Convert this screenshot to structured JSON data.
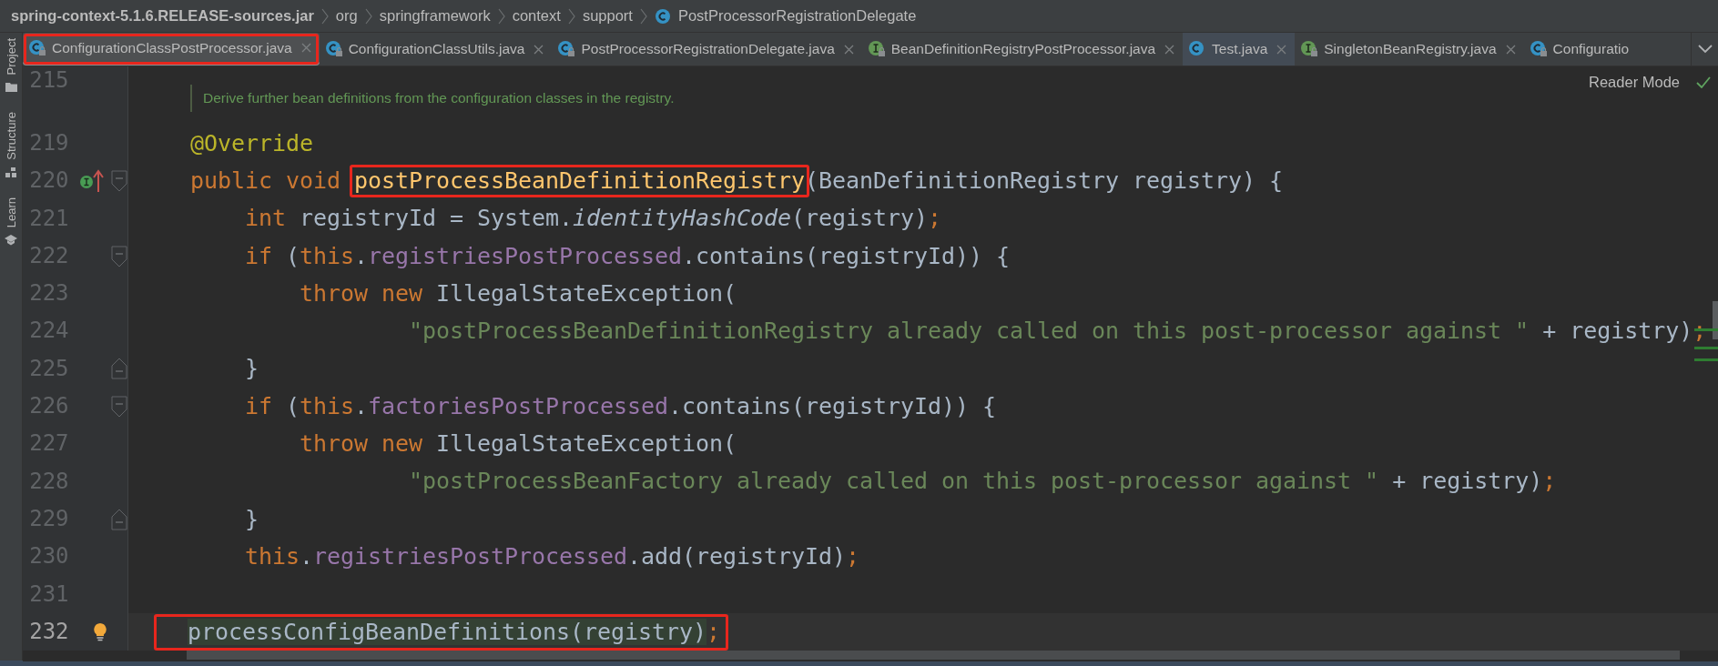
{
  "breadcrumb": [
    {
      "label": "spring-context-5.1.6.RELEASE-sources.jar",
      "kind": "jar"
    },
    {
      "label": "org",
      "kind": "package"
    },
    {
      "label": "springframework",
      "kind": "package"
    },
    {
      "label": "context",
      "kind": "package"
    },
    {
      "label": "support",
      "kind": "package"
    },
    {
      "label": "PostProcessorRegistrationDelegate",
      "kind": "class"
    }
  ],
  "tool_strip": [
    {
      "label": "Project",
      "kind": "project"
    },
    {
      "label": "Structure",
      "kind": "structure"
    },
    {
      "label": "Learn",
      "kind": "learn"
    }
  ],
  "tabs": [
    {
      "label": "ConfigurationClassPostProcessor.java",
      "kind": "class",
      "locked": true,
      "selected": true,
      "hovered": false,
      "outlined": true,
      "closable": true
    },
    {
      "label": "ConfigurationClassUtils.java",
      "kind": "class",
      "locked": true,
      "selected": false,
      "hovered": false,
      "outlined": false,
      "closable": true
    },
    {
      "label": "PostProcessorRegistrationDelegate.java",
      "kind": "class",
      "locked": true,
      "selected": false,
      "hovered": false,
      "outlined": false,
      "closable": true
    },
    {
      "label": "BeanDefinitionRegistryPostProcessor.java",
      "kind": "interface",
      "locked": true,
      "selected": false,
      "hovered": false,
      "outlined": false,
      "closable": true
    },
    {
      "label": "Test.java",
      "kind": "class",
      "locked": false,
      "selected": false,
      "hovered": true,
      "outlined": false,
      "closable": true
    },
    {
      "label": "SingletonBeanRegistry.java",
      "kind": "interface",
      "locked": true,
      "selected": false,
      "hovered": false,
      "outlined": false,
      "closable": true
    },
    {
      "label": "Configuratio",
      "kind": "class",
      "locked": true,
      "selected": false,
      "hovered": false,
      "outlined": false,
      "closable": false
    }
  ],
  "reader_mode": {
    "label": "Reader Mode"
  },
  "doc_comment": {
    "line_number": "215",
    "text": "Derive further bean definitions from the configuration classes in the registry."
  },
  "code": {
    "lines": [
      {
        "number": "219",
        "current": false,
        "tokens": [
          {
            "text": "@Override",
            "kind": "annotation"
          }
        ]
      },
      {
        "number": "220",
        "implements_marker": true,
        "fold_start": true,
        "current": false,
        "tokens": [
          {
            "text": "public void ",
            "kind": "keyword"
          },
          {
            "text": "postProcessBeanDefinitionRegistry",
            "kind": "method",
            "outlined": true
          },
          {
            "text": "(BeanDefinitionRegistry registry) {",
            "kind": "plain"
          }
        ]
      },
      {
        "number": "221",
        "current": false,
        "tokens": [
          {
            "text": "    int",
            "kind": "keyword"
          },
          {
            "text": " registryId = System.",
            "kind": "plain"
          },
          {
            "text": "identityHashCode",
            "kind": "static"
          },
          {
            "text": "(registry)",
            "kind": "plain"
          },
          {
            "text": ";",
            "kind": "keyword"
          }
        ]
      },
      {
        "number": "222",
        "fold_start": true,
        "current": false,
        "tokens": [
          {
            "text": "    if",
            "kind": "keyword"
          },
          {
            "text": " (",
            "kind": "plain"
          },
          {
            "text": "this",
            "kind": "keyword"
          },
          {
            "text": ".",
            "kind": "plain"
          },
          {
            "text": "registriesPostProcessed",
            "kind": "field"
          },
          {
            "text": ".contains(registryId)) {",
            "kind": "plain"
          }
        ]
      },
      {
        "number": "223",
        "current": false,
        "tokens": [
          {
            "text": "        throw new",
            "kind": "keyword"
          },
          {
            "text": " IllegalStateException(",
            "kind": "plain"
          }
        ]
      },
      {
        "number": "224",
        "current": false,
        "tokens": [
          {
            "text": "                \"postProcessBeanDefinitionRegistry already called on this post-processor against \"",
            "kind": "string"
          },
          {
            "text": " + registry)",
            "kind": "plain"
          },
          {
            "text": ";",
            "kind": "keyword"
          }
        ]
      },
      {
        "number": "225",
        "fold_end": true,
        "current": false,
        "tokens": [
          {
            "text": "    }",
            "kind": "plain"
          }
        ]
      },
      {
        "number": "226",
        "fold_start": true,
        "current": false,
        "tokens": [
          {
            "text": "    if",
            "kind": "keyword"
          },
          {
            "text": " (",
            "kind": "plain"
          },
          {
            "text": "this",
            "kind": "keyword"
          },
          {
            "text": ".",
            "kind": "plain"
          },
          {
            "text": "factoriesPostProcessed",
            "kind": "field"
          },
          {
            "text": ".contains(registryId)) {",
            "kind": "plain"
          }
        ]
      },
      {
        "number": "227",
        "current": false,
        "tokens": [
          {
            "text": "        throw new",
            "kind": "keyword"
          },
          {
            "text": " IllegalStateException(",
            "kind": "plain"
          }
        ]
      },
      {
        "number": "228",
        "current": false,
        "tokens": [
          {
            "text": "                \"postProcessBeanFactory already called on this post-processor against \"",
            "kind": "string"
          },
          {
            "text": " + registry)",
            "kind": "plain"
          },
          {
            "text": ";",
            "kind": "keyword"
          }
        ]
      },
      {
        "number": "229",
        "fold_end": true,
        "current": false,
        "tokens": [
          {
            "text": "    }",
            "kind": "plain"
          }
        ]
      },
      {
        "number": "230",
        "current": false,
        "tokens": [
          {
            "text": "    this",
            "kind": "keyword"
          },
          {
            "text": ".",
            "kind": "plain"
          },
          {
            "text": "registriesPostProcessed",
            "kind": "field"
          },
          {
            "text": ".add(registryId)",
            "kind": "plain"
          },
          {
            "text": ";",
            "kind": "keyword"
          }
        ]
      },
      {
        "number": "231",
        "current": false
      },
      {
        "number": "232",
        "bulb": true,
        "current": true,
        "outlined": true,
        "tokens": [
          {
            "text": "processConfigBeanDefinitions(registry)",
            "kind": "plain",
            "usage": true
          },
          {
            "text": ";",
            "kind": "keyword"
          }
        ]
      }
    ]
  }
}
